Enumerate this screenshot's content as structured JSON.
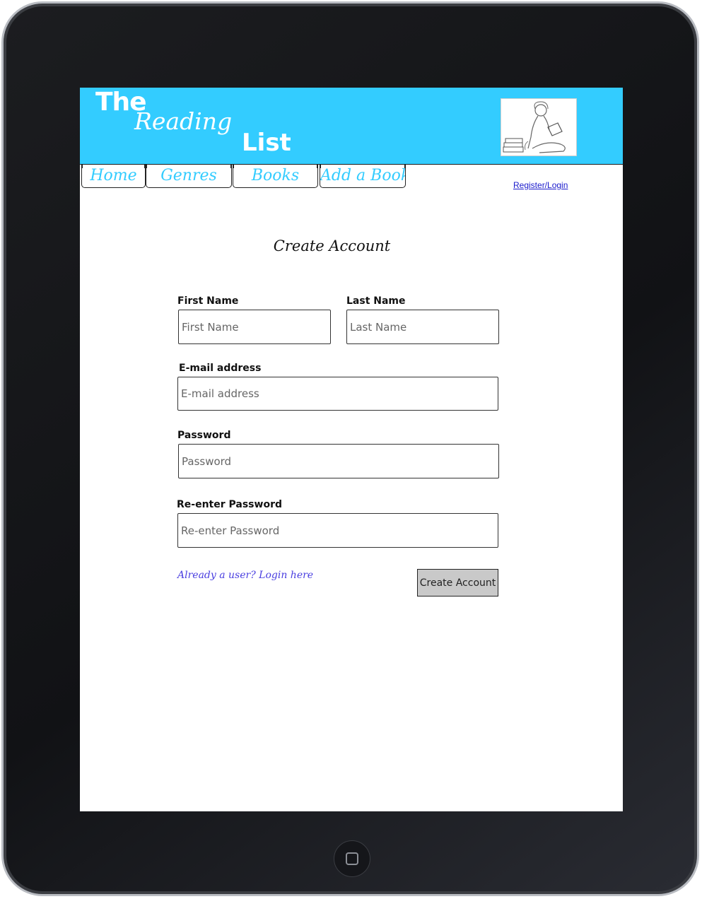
{
  "header": {
    "logo_the": "The",
    "logo_reading": "Reading",
    "logo_list": "List",
    "image_icon": "reading-child-illustration-icon"
  },
  "nav": {
    "tabs": [
      {
        "label": "Home"
      },
      {
        "label": "Genres"
      },
      {
        "label": "Books"
      },
      {
        "label": "Add a Book"
      }
    ],
    "register_login": "Register/Login"
  },
  "form": {
    "title": "Create Account",
    "first_name": {
      "label": "First Name",
      "placeholder": "First Name"
    },
    "last_name": {
      "label": "Last Name",
      "placeholder": "Last Name"
    },
    "email": {
      "label": "E-mail address",
      "placeholder": "E-mail address"
    },
    "password": {
      "label": "Password",
      "placeholder": "Password"
    },
    "reenter_password": {
      "label": "Re-enter Password",
      "placeholder": "Re-enter Password"
    },
    "login_link": "Already a user? Login here",
    "submit_label": "Create Account"
  },
  "colors": {
    "header_bg": "#33ccff",
    "tab_text": "#33ccff",
    "link": "#1a1acc",
    "login_link": "#4a3fe0",
    "button_bg": "#c9c9c9"
  }
}
